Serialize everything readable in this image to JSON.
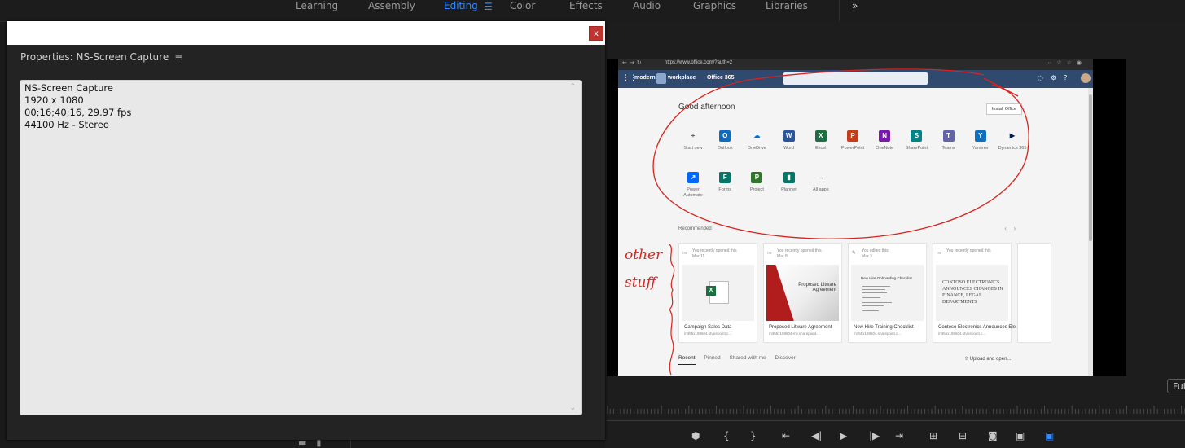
{
  "workspaces": {
    "tabs": [
      "Learning",
      "Assembly",
      "Editing",
      "Color",
      "Effects",
      "Audio",
      "Graphics",
      "Libraries"
    ],
    "active": "Editing",
    "more_label": "»"
  },
  "dialog": {
    "close_label": "x",
    "panel_title": "Properties: NS-Screen Capture",
    "menu_glyph": "≡",
    "properties": [
      "NS-Screen Capture",
      "1920 x 1080",
      "00;16;40;16, 29.97 fps",
      "44100 Hz - Stereo"
    ]
  },
  "monitor": {
    "fit_label": "Ful",
    "screen": {
      "url": "https://www.office.com/?auth=2",
      "brand_left": "modern",
      "brand_right": "workplace",
      "suite": "Office 365",
      "greeting": "Good afternoon",
      "install": "Install Office",
      "apps_row1": [
        {
          "label": "Start new",
          "glyph": "+",
          "color": "#f4f4f4",
          "fg": "#555"
        },
        {
          "label": "Outlook",
          "glyph": "O",
          "color": "#0f6cbd",
          "fg": "#fff"
        },
        {
          "label": "OneDrive",
          "glyph": "☁",
          "color": "#f4f4f4",
          "fg": "#0a6ed1"
        },
        {
          "label": "Word",
          "glyph": "W",
          "color": "#2b579a",
          "fg": "#fff"
        },
        {
          "label": "Excel",
          "glyph": "X",
          "color": "#1d6f42",
          "fg": "#fff"
        },
        {
          "label": "PowerPoint",
          "glyph": "P",
          "color": "#c43e1c",
          "fg": "#fff"
        },
        {
          "label": "OneNote",
          "glyph": "N",
          "color": "#7719aa",
          "fg": "#fff"
        },
        {
          "label": "SharePoint",
          "glyph": "S",
          "color": "#038387",
          "fg": "#fff"
        },
        {
          "label": "Teams",
          "glyph": "T",
          "color": "#6264a7",
          "fg": "#fff"
        },
        {
          "label": "Yammer",
          "glyph": "Y",
          "color": "#106ebe",
          "fg": "#fff"
        },
        {
          "label": "Dynamics 365",
          "glyph": "▶",
          "color": "#f4f4f4",
          "fg": "#002050"
        }
      ],
      "apps_row2": [
        {
          "label": "Power Automate",
          "glyph": "↗",
          "color": "#0066ff",
          "fg": "#fff"
        },
        {
          "label": "Forms",
          "glyph": "F",
          "color": "#077568",
          "fg": "#fff"
        },
        {
          "label": "Project",
          "glyph": "P",
          "color": "#31752f",
          "fg": "#fff"
        },
        {
          "label": "Planner",
          "glyph": "▮",
          "color": "#077568",
          "fg": "#fff"
        },
        {
          "label": "All apps",
          "glyph": "→",
          "color": "#f4f4f4",
          "fg": "#555"
        }
      ],
      "recommended": "Recommended",
      "cards": [
        {
          "action": "You recently opened this",
          "date": "Mar 11",
          "name": "Campaign Sales Data",
          "path": "m365x189604.sharepoint.c..."
        },
        {
          "action": "You recently opened this",
          "date": "Mar 8",
          "name": "Proposed Litware Agreement",
          "path": "m365x189604-my.sharepoint..."
        },
        {
          "action": "You edited this",
          "date": "Mar 3",
          "name": "New Hire Training Checklist",
          "path": "m365x189604.sharepoint.c..."
        },
        {
          "action": "You recently opened this",
          "date": "",
          "name": "Contoso Electronics Announces Ele...",
          "path": "m365x189604.sharepoint.c..."
        }
      ],
      "ppt_slide_title": "Proposed Litware Agreement",
      "doc_title": "New Hire Onboarding Checklist",
      "contoso_text": "CONTOSO ELECTRONICS ANNOUNCES CHANGES IN FINANCE, LEGAL DEPARTMENTS",
      "file_tabs": [
        "Recent",
        "Pinned",
        "Shared with me",
        "Discover"
      ],
      "upload": "Upload and open...",
      "annotation": "other stuff"
    }
  },
  "colors": {
    "accent": "#2f8bff",
    "close": "#c0342f",
    "annotation": "#d9231f"
  }
}
